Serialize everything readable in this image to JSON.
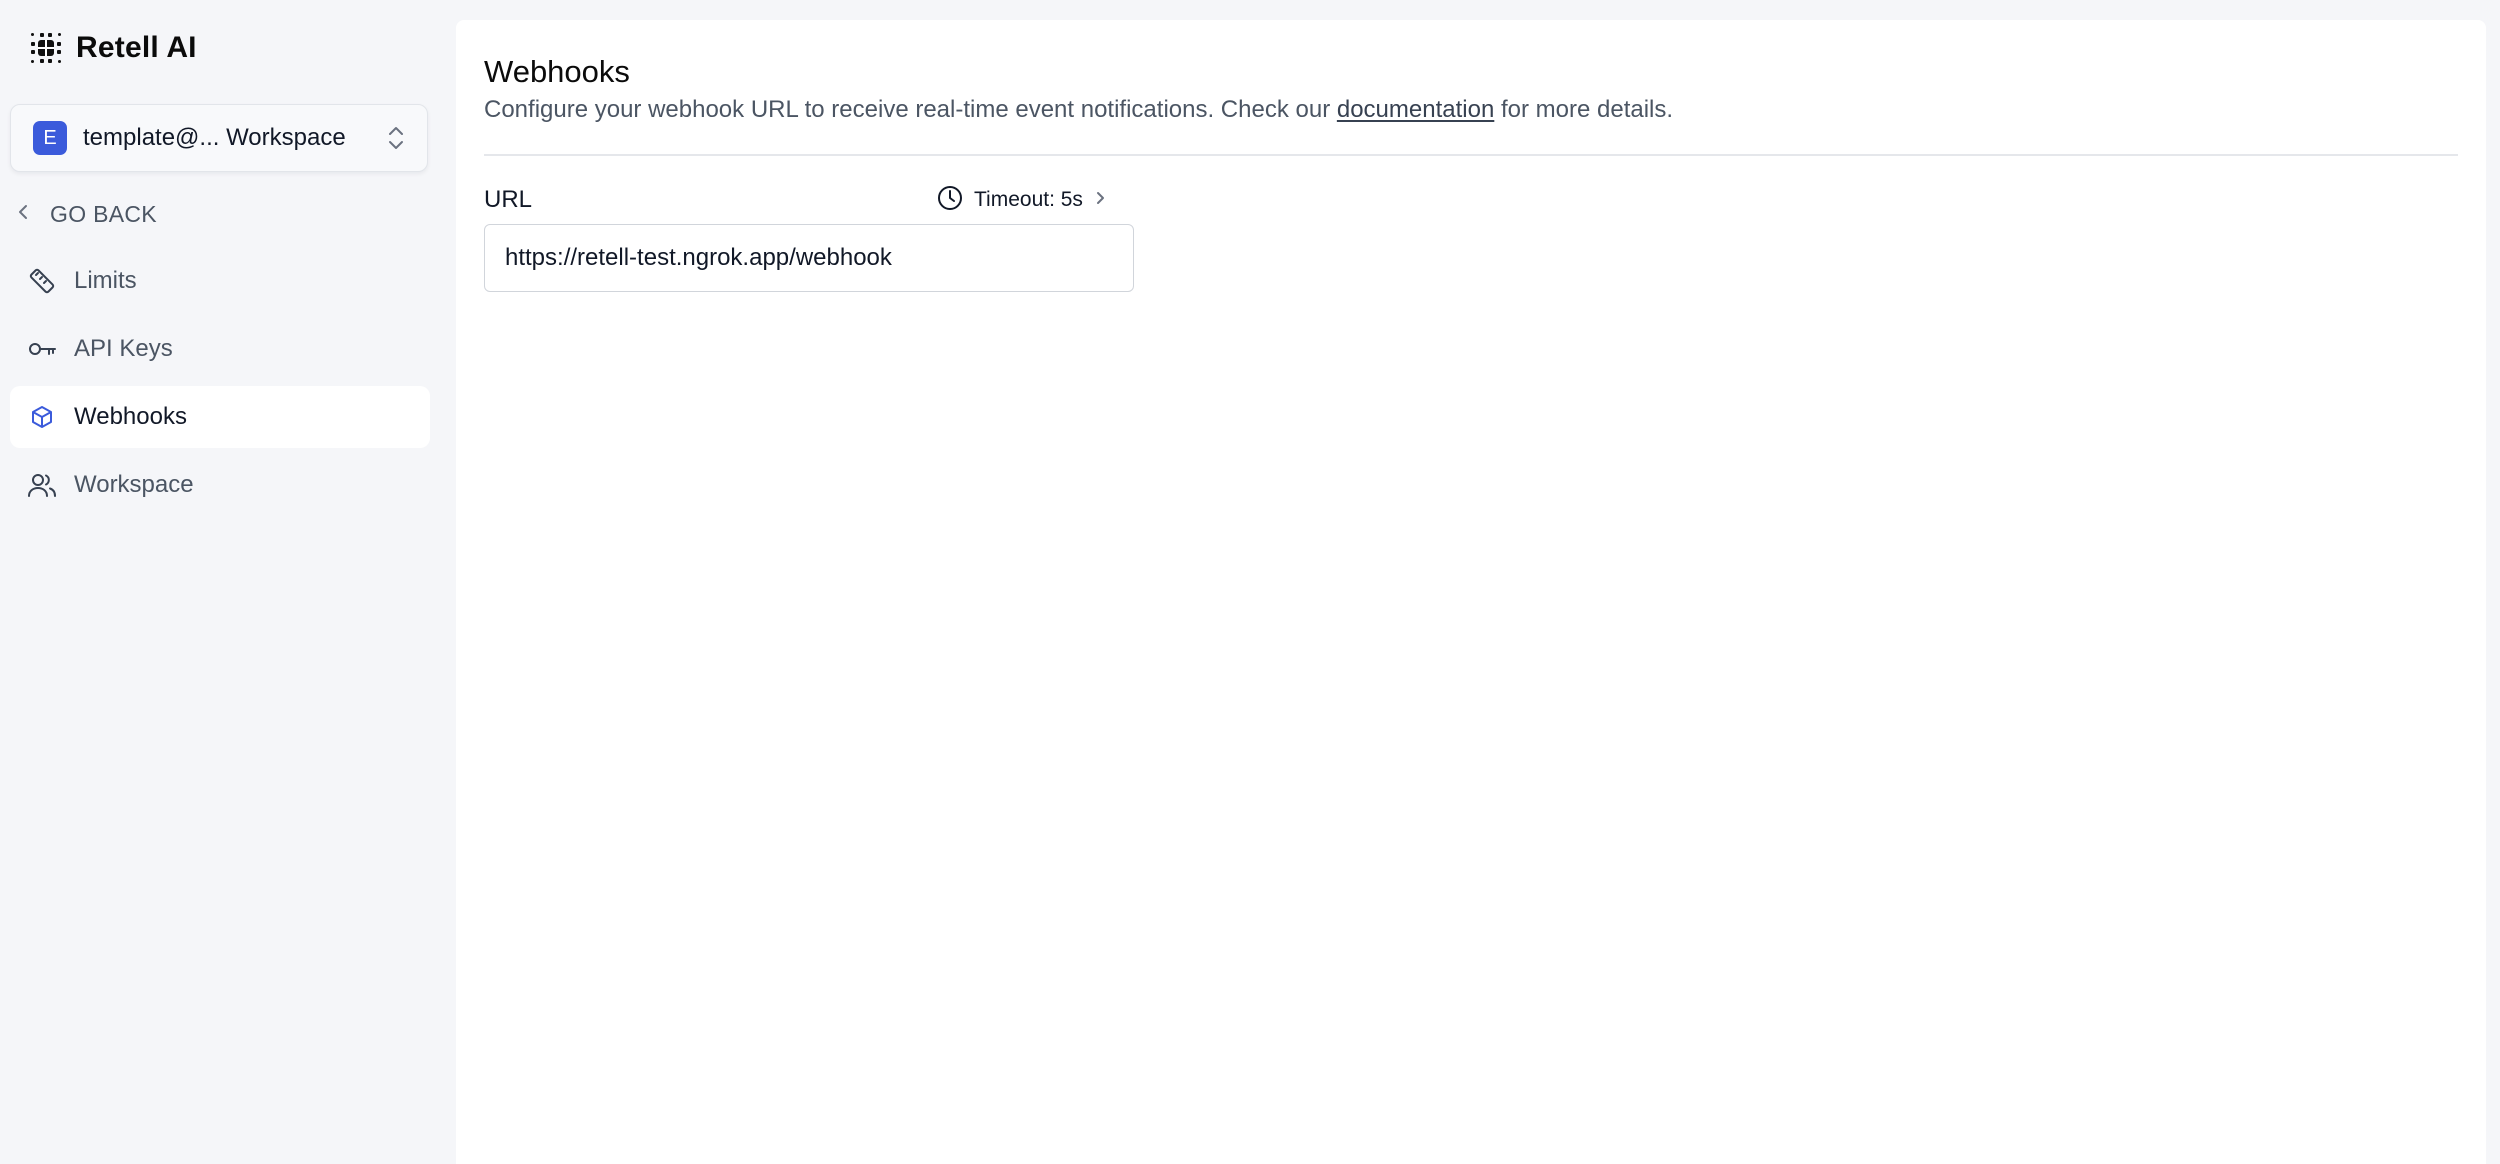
{
  "brand": {
    "name": "Retell AI",
    "logo_icon": "retell-logo-icon"
  },
  "workspace_switcher": {
    "avatar_letter": "E",
    "label": "template@... Workspace",
    "avatar_color": "#3b5bdb"
  },
  "sidebar": {
    "go_back_label": "GO BACK",
    "items": [
      {
        "label": "Limits",
        "icon": "ruler-icon",
        "active": false
      },
      {
        "label": "API Keys",
        "icon": "key-icon",
        "active": false
      },
      {
        "label": "Webhooks",
        "icon": "webhook-cube-icon",
        "active": true
      },
      {
        "label": "Workspace",
        "icon": "users-icon",
        "active": false
      }
    ]
  },
  "main": {
    "title": "Webhooks",
    "description_prefix": "Configure your webhook URL to receive real-time event notifications. Check our ",
    "description_link": "documentation",
    "description_suffix": " for more details.",
    "url_field": {
      "label": "URL",
      "value": "https://retell-test.ngrok.app/webhook",
      "timeout_label": "Timeout: 5s"
    }
  },
  "colors": {
    "accent": "#3b5bdb",
    "background": "#f5f6f9",
    "panel": "#ffffff"
  }
}
